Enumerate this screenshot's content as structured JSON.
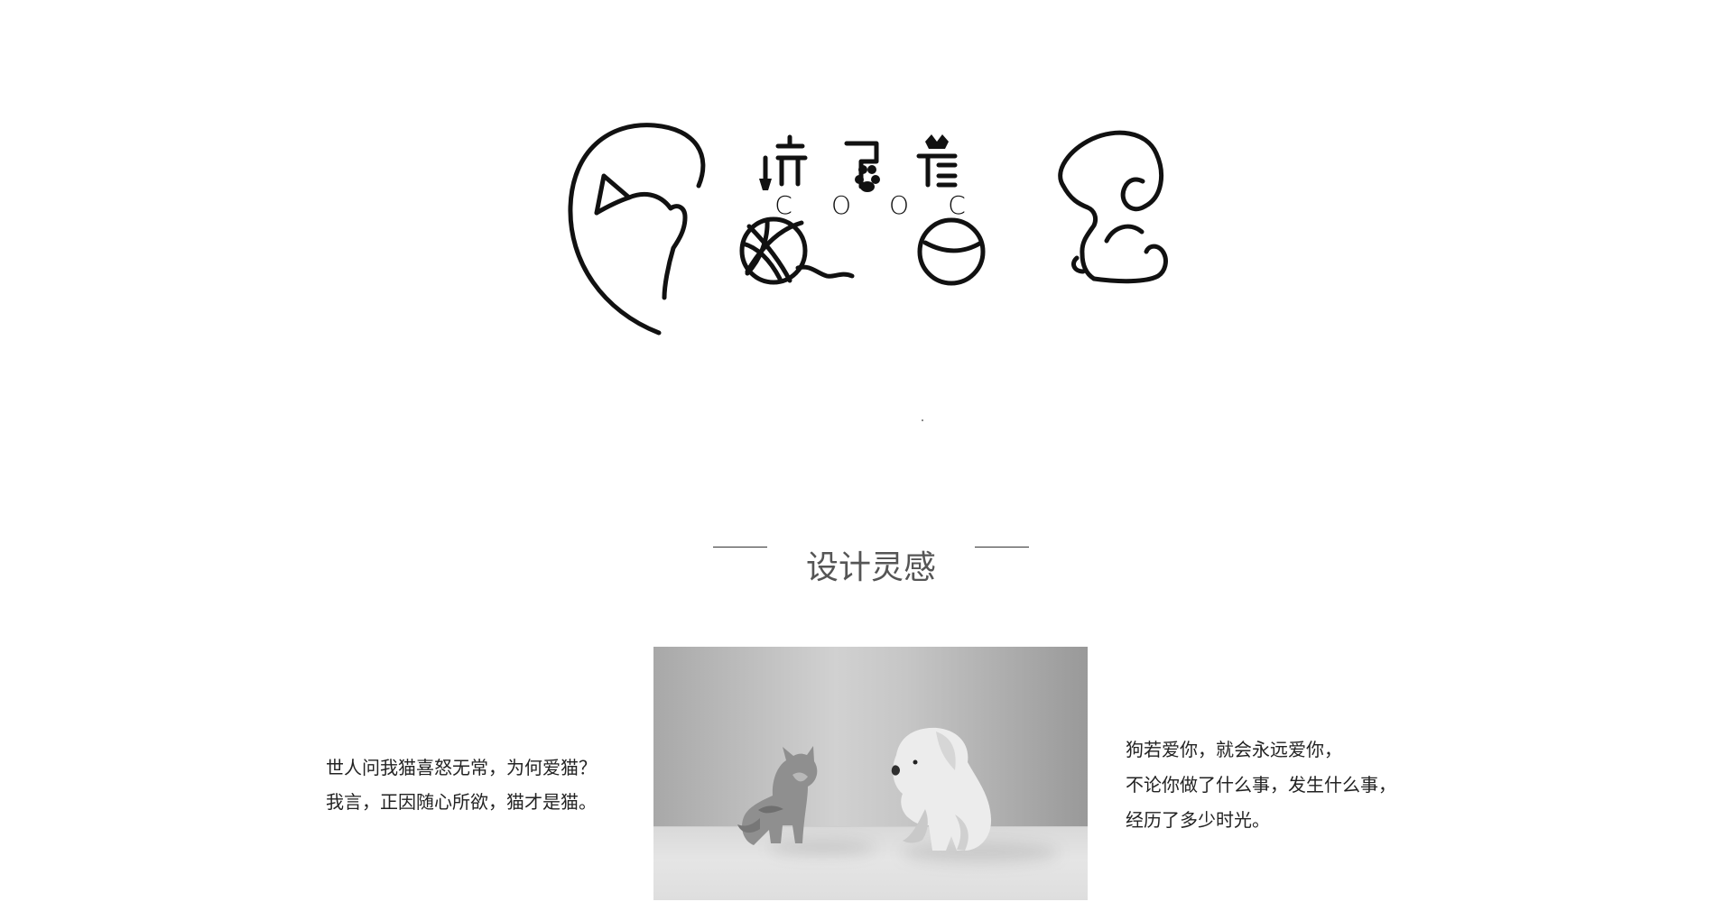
{
  "logo": {
    "brand_text": "COOC",
    "letters": [
      "C",
      "O",
      "O",
      "C"
    ],
    "icons": [
      "cat-outline-icon",
      "yarn-ball-icon",
      "tennis-ball-icon",
      "dog-outline-icon",
      "paw-icon",
      "crown-icon",
      "shovel-icon"
    ],
    "color": "#111111"
  },
  "section": {
    "title": "设计灵感"
  },
  "inspiration": {
    "left_lines": [
      "世人问我猫喜怒无常，为何爱猫？",
      "我言，正因随心所欲，猫才是猫。"
    ],
    "right_lines": [
      "狗若爱你，就会永远爱你，",
      "不论你做了什么事，发生什么事，",
      "经历了多少时光。"
    ]
  },
  "photo": {
    "subject": "cat-and-puppy-photo",
    "tone": "grayscale"
  }
}
